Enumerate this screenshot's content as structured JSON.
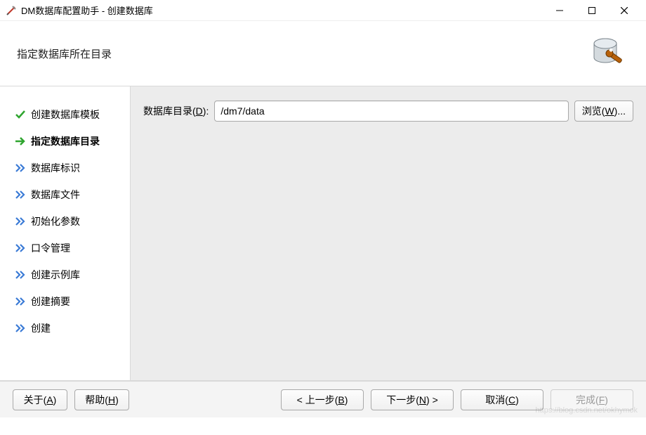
{
  "window": {
    "title": "DM数据库配置助手 - 创建数据库"
  },
  "header": {
    "page_title": "指定数据库所在目录"
  },
  "sidebar": {
    "steps": [
      {
        "label": "创建数据库模板",
        "state": "done"
      },
      {
        "label": "指定数据库目录",
        "state": "current"
      },
      {
        "label": "数据库标识",
        "state": "pending"
      },
      {
        "label": "数据库文件",
        "state": "pending"
      },
      {
        "label": "初始化参数",
        "state": "pending"
      },
      {
        "label": "口令管理",
        "state": "pending"
      },
      {
        "label": "创建示例库",
        "state": "pending"
      },
      {
        "label": "创建摘要",
        "state": "pending"
      },
      {
        "label": "创建",
        "state": "pending"
      }
    ]
  },
  "main": {
    "dir_label_prefix": "数据库目录(",
    "dir_label_hotkey": "D",
    "dir_label_suffix": "):",
    "dir_value": "/dm7/data",
    "browse_prefix": "浏览(",
    "browse_hotkey": "W",
    "browse_suffix": ")..."
  },
  "footer": {
    "about_prefix": "关于(",
    "about_hotkey": "A",
    "about_suffix": ")",
    "help_prefix": "帮助(",
    "help_hotkey": "H",
    "help_suffix": ")",
    "back_prefix": "< 上一步(",
    "back_hotkey": "B",
    "back_suffix": ")",
    "next_prefix": "下一步(",
    "next_hotkey": "N",
    "next_suffix": ") >",
    "cancel_prefix": "取消(",
    "cancel_hotkey": "C",
    "cancel_suffix": ")",
    "finish_prefix": "完成(",
    "finish_hotkey": "F",
    "finish_suffix": ")"
  },
  "watermark": "https://blog.csdn.net/okhymok"
}
